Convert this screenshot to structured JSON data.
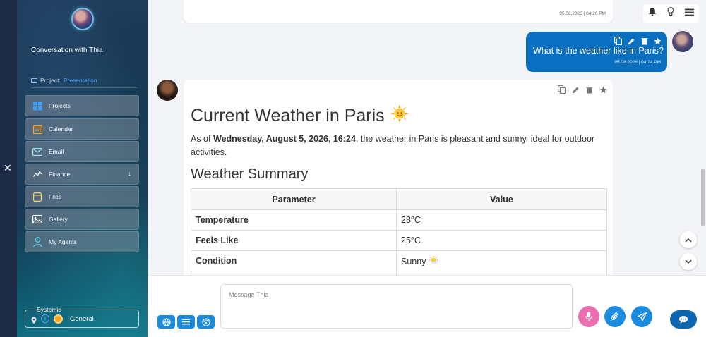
{
  "sidebar": {
    "conversation_title": "Conversation with Thia",
    "project_label": "Project:",
    "project_value": "Presentation",
    "nav": [
      {
        "label": "Projects",
        "icon": "grid-icon"
      },
      {
        "label": "Calendar",
        "icon": "calendar-icon"
      },
      {
        "label": "Email",
        "icon": "mail-icon"
      },
      {
        "label": "Finance",
        "icon": "chart-line-icon"
      },
      {
        "label": "Files",
        "icon": "file-icon"
      },
      {
        "label": "Gallery",
        "icon": "image-icon"
      },
      {
        "label": "My Agents",
        "icon": "user-icon"
      }
    ],
    "systemic_legend": "Systemic",
    "systemic_value": "General"
  },
  "chat": {
    "prev_timestamp": "05.08.2026 | 04:20 PM",
    "user_message": "What is the weather like in Paris?",
    "user_timestamp": "05.08.2026 | 04:24 PM",
    "bot": {
      "heading": "Current Weather in Paris",
      "para_prefix": "As of ",
      "para_bold": "Wednesday, August 5, 2026, 16:24",
      "para_suffix": ", the weather in Paris is pleasant and sunny, ideal for outdoor activities.",
      "subheading": "Weather Summary",
      "table": {
        "headers": [
          "Parameter",
          "Value"
        ],
        "rows": [
          [
            "Temperature",
            "28°C"
          ],
          [
            "Feels Like",
            "25°C"
          ],
          [
            "Condition",
            "Sunny"
          ]
        ]
      }
    }
  },
  "composer": {
    "placeholder": "Message Thia"
  },
  "colors": {
    "accent": "#0b6fbf",
    "mic": "#ea6fb1",
    "send": "#1b8be0"
  }
}
